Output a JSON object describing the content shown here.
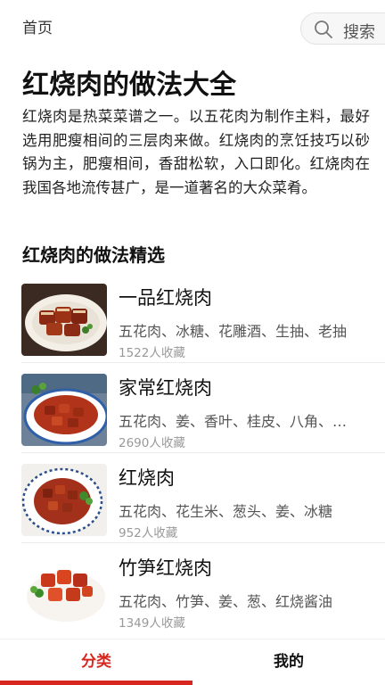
{
  "header": {
    "home": "首页",
    "search": "搜索"
  },
  "page_title": "红烧肉的做法大全",
  "intro": "红烧肉是热菜菜谱之一。以五花肉为制作主料，最好选用肥瘦相间的三层肉来做。红烧肉的烹饪技巧以砂锅为主，肥瘦相间，香甜松软，入口即化。红烧肉在我国各地流传甚广，是一道著名的大众菜肴。",
  "section_title": "红烧肉的做法精选",
  "recipes": [
    {
      "name": "一品红烧肉",
      "ingredients": "五花肉、冰糖、花雕酒、生抽、老抽",
      "favorites": "1522人收藏"
    },
    {
      "name": "家常红烧肉",
      "ingredients": "五花肉、姜、香叶、桂皮、八角、冰糖",
      "favorites": "2690人收藏"
    },
    {
      "name": "红烧肉",
      "ingredients": "五花肉、花生米、葱头、姜、冰糖",
      "favorites": "952人收藏"
    },
    {
      "name": "竹笋红烧肉",
      "ingredients": "五花肉、竹笋、姜、葱、红烧酱油",
      "favorites": "1349人收藏"
    }
  ],
  "tabs": {
    "category": "分类",
    "mine": "我的"
  },
  "colors": {
    "accent": "#d7261e"
  }
}
